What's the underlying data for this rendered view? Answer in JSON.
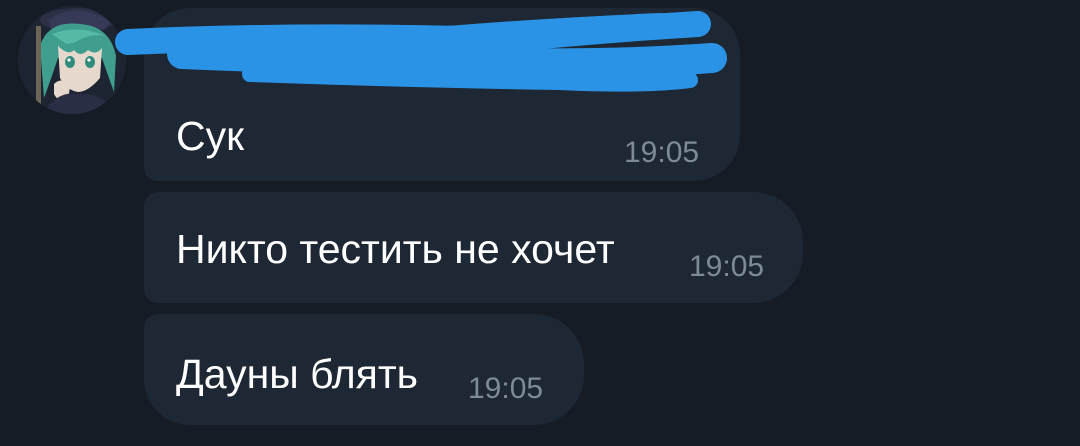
{
  "colors": {
    "background": "#151c25",
    "bubble": "#1e2734",
    "message_text": "#ffffff",
    "timestamp": "#7e8a99",
    "redaction": "#2b93e6"
  },
  "sender": {
    "avatar_icon": "anime-character-avatar"
  },
  "messages": [
    {
      "text": "Сук",
      "time": "19:05"
    },
    {
      "text": "Никто тестить не хочет",
      "time": "19:05"
    },
    {
      "text": "Дауны блять",
      "time": "19:05"
    }
  ]
}
